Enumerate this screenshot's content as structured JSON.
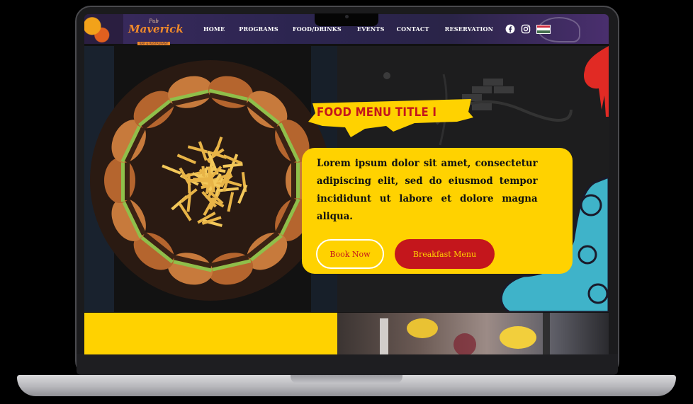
{
  "brand": {
    "logo_small": "Pub",
    "logo_main": "Maverick",
    "logo_tagline": "BAR & RESTAURANT"
  },
  "nav": {
    "items": [
      {
        "label": "HOME"
      },
      {
        "label": "PROGRAMS"
      },
      {
        "label": "FOOD/DRINKS"
      },
      {
        "label": "EVENTS"
      },
      {
        "label": "CONTACT"
      },
      {
        "label": "RESERVATION"
      }
    ],
    "socials": [
      "facebook-icon",
      "instagram-icon",
      "hungary-flag-icon"
    ]
  },
  "hero": {
    "title": "FOOD MENU TITLE I",
    "body": "Lorem ipsum dolor sit amet, consectetur adipiscing elit, sed do eiusmod tempor incididunt ut labore et dolore magna aliqua.",
    "book_button": "Book Now",
    "breakfast_button": "Breakfast Menu"
  },
  "colors": {
    "accent_yellow": "#ffd200",
    "accent_red": "#c4161c",
    "nav_purple": "#2c2550",
    "logo_orange": "#f08a2a"
  }
}
